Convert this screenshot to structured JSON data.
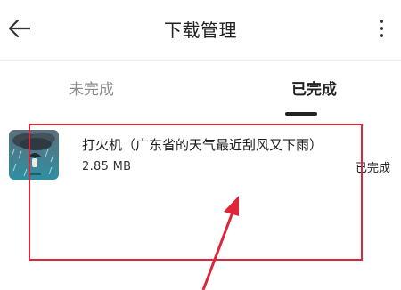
{
  "header": {
    "title": "下载管理",
    "back_icon": "arrow-left-icon",
    "more_icon": "more-vertical-icon"
  },
  "tabs": [
    {
      "label": "未完成",
      "active": false
    },
    {
      "label": "已完成",
      "active": true
    }
  ],
  "downloads": [
    {
      "title": "打火机（广东省的天气最近刮风又下雨）",
      "size": "2.85 MB",
      "status": "已完成",
      "thumbnail_icon": "rainy-weather-thumbnail"
    }
  ],
  "colors": {
    "annotation": "#e0243a",
    "text_primary": "#222222",
    "text_secondary": "#8a8a8a"
  }
}
